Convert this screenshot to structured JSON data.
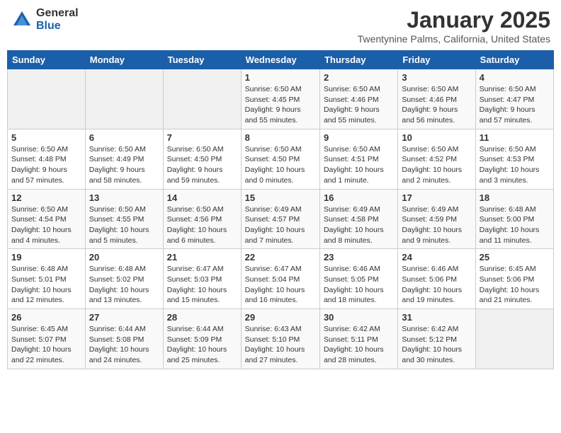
{
  "header": {
    "logo_general": "General",
    "logo_blue": "Blue",
    "title": "January 2025",
    "subtitle": "Twentynine Palms, California, United States"
  },
  "weekdays": [
    "Sunday",
    "Monday",
    "Tuesday",
    "Wednesday",
    "Thursday",
    "Friday",
    "Saturday"
  ],
  "weeks": [
    [
      {
        "day": "",
        "info": ""
      },
      {
        "day": "",
        "info": ""
      },
      {
        "day": "",
        "info": ""
      },
      {
        "day": "1",
        "info": "Sunrise: 6:50 AM\nSunset: 4:45 PM\nDaylight: 9 hours\nand 55 minutes."
      },
      {
        "day": "2",
        "info": "Sunrise: 6:50 AM\nSunset: 4:46 PM\nDaylight: 9 hours\nand 55 minutes."
      },
      {
        "day": "3",
        "info": "Sunrise: 6:50 AM\nSunset: 4:46 PM\nDaylight: 9 hours\nand 56 minutes."
      },
      {
        "day": "4",
        "info": "Sunrise: 6:50 AM\nSunset: 4:47 PM\nDaylight: 9 hours\nand 57 minutes."
      }
    ],
    [
      {
        "day": "5",
        "info": "Sunrise: 6:50 AM\nSunset: 4:48 PM\nDaylight: 9 hours\nand 57 minutes."
      },
      {
        "day": "6",
        "info": "Sunrise: 6:50 AM\nSunset: 4:49 PM\nDaylight: 9 hours\nand 58 minutes."
      },
      {
        "day": "7",
        "info": "Sunrise: 6:50 AM\nSunset: 4:50 PM\nDaylight: 9 hours\nand 59 minutes."
      },
      {
        "day": "8",
        "info": "Sunrise: 6:50 AM\nSunset: 4:50 PM\nDaylight: 10 hours\nand 0 minutes."
      },
      {
        "day": "9",
        "info": "Sunrise: 6:50 AM\nSunset: 4:51 PM\nDaylight: 10 hours\nand 1 minute."
      },
      {
        "day": "10",
        "info": "Sunrise: 6:50 AM\nSunset: 4:52 PM\nDaylight: 10 hours\nand 2 minutes."
      },
      {
        "day": "11",
        "info": "Sunrise: 6:50 AM\nSunset: 4:53 PM\nDaylight: 10 hours\nand 3 minutes."
      }
    ],
    [
      {
        "day": "12",
        "info": "Sunrise: 6:50 AM\nSunset: 4:54 PM\nDaylight: 10 hours\nand 4 minutes."
      },
      {
        "day": "13",
        "info": "Sunrise: 6:50 AM\nSunset: 4:55 PM\nDaylight: 10 hours\nand 5 minutes."
      },
      {
        "day": "14",
        "info": "Sunrise: 6:50 AM\nSunset: 4:56 PM\nDaylight: 10 hours\nand 6 minutes."
      },
      {
        "day": "15",
        "info": "Sunrise: 6:49 AM\nSunset: 4:57 PM\nDaylight: 10 hours\nand 7 minutes."
      },
      {
        "day": "16",
        "info": "Sunrise: 6:49 AM\nSunset: 4:58 PM\nDaylight: 10 hours\nand 8 minutes."
      },
      {
        "day": "17",
        "info": "Sunrise: 6:49 AM\nSunset: 4:59 PM\nDaylight: 10 hours\nand 9 minutes."
      },
      {
        "day": "18",
        "info": "Sunrise: 6:48 AM\nSunset: 5:00 PM\nDaylight: 10 hours\nand 11 minutes."
      }
    ],
    [
      {
        "day": "19",
        "info": "Sunrise: 6:48 AM\nSunset: 5:01 PM\nDaylight: 10 hours\nand 12 minutes."
      },
      {
        "day": "20",
        "info": "Sunrise: 6:48 AM\nSunset: 5:02 PM\nDaylight: 10 hours\nand 13 minutes."
      },
      {
        "day": "21",
        "info": "Sunrise: 6:47 AM\nSunset: 5:03 PM\nDaylight: 10 hours\nand 15 minutes."
      },
      {
        "day": "22",
        "info": "Sunrise: 6:47 AM\nSunset: 5:04 PM\nDaylight: 10 hours\nand 16 minutes."
      },
      {
        "day": "23",
        "info": "Sunrise: 6:46 AM\nSunset: 5:05 PM\nDaylight: 10 hours\nand 18 minutes."
      },
      {
        "day": "24",
        "info": "Sunrise: 6:46 AM\nSunset: 5:06 PM\nDaylight: 10 hours\nand 19 minutes."
      },
      {
        "day": "25",
        "info": "Sunrise: 6:45 AM\nSunset: 5:06 PM\nDaylight: 10 hours\nand 21 minutes."
      }
    ],
    [
      {
        "day": "26",
        "info": "Sunrise: 6:45 AM\nSunset: 5:07 PM\nDaylight: 10 hours\nand 22 minutes."
      },
      {
        "day": "27",
        "info": "Sunrise: 6:44 AM\nSunset: 5:08 PM\nDaylight: 10 hours\nand 24 minutes."
      },
      {
        "day": "28",
        "info": "Sunrise: 6:44 AM\nSunset: 5:09 PM\nDaylight: 10 hours\nand 25 minutes."
      },
      {
        "day": "29",
        "info": "Sunrise: 6:43 AM\nSunset: 5:10 PM\nDaylight: 10 hours\nand 27 minutes."
      },
      {
        "day": "30",
        "info": "Sunrise: 6:42 AM\nSunset: 5:11 PM\nDaylight: 10 hours\nand 28 minutes."
      },
      {
        "day": "31",
        "info": "Sunrise: 6:42 AM\nSunset: 5:12 PM\nDaylight: 10 hours\nand 30 minutes."
      },
      {
        "day": "",
        "info": ""
      }
    ]
  ]
}
